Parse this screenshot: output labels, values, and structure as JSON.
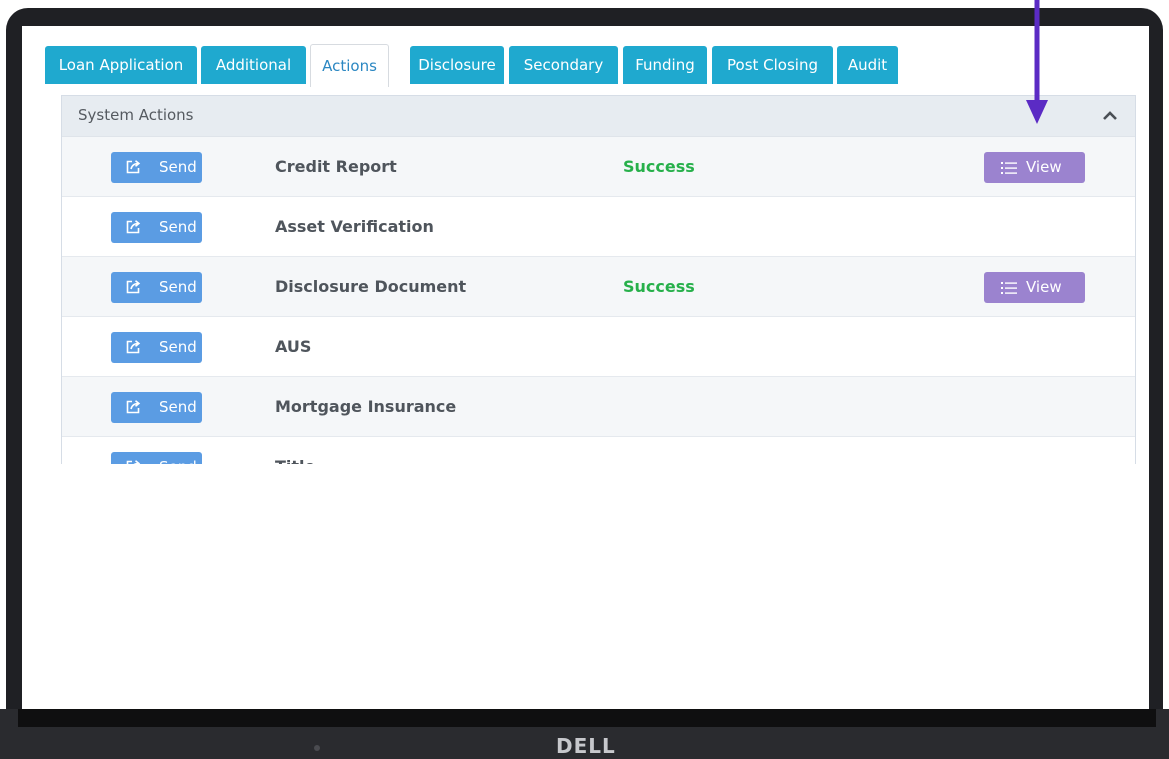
{
  "tabs": [
    {
      "label": "Loan Application",
      "active": false
    },
    {
      "label": "Additional",
      "active": false
    },
    {
      "label": "Actions",
      "active": true
    },
    {
      "label": "Disclosure",
      "active": false
    },
    {
      "label": "Secondary",
      "active": false
    },
    {
      "label": "Funding",
      "active": false
    },
    {
      "label": "Post Closing",
      "active": false
    },
    {
      "label": "Audit",
      "active": false
    }
  ],
  "panel": {
    "title": "System Actions",
    "collapse_icon": "chevron-up-icon"
  },
  "rows": [
    {
      "send_label": "Send",
      "name": "Credit Report",
      "status": "Success",
      "view_label": "View"
    },
    {
      "send_label": "Send",
      "name": "Asset Verification",
      "status": "",
      "view_label": ""
    },
    {
      "send_label": "Send",
      "name": "Disclosure Document",
      "status": "Success",
      "view_label": "View"
    },
    {
      "send_label": "Send",
      "name": "AUS",
      "status": "",
      "view_label": ""
    },
    {
      "send_label": "Send",
      "name": "Mortgage Insurance",
      "status": "",
      "view_label": ""
    },
    {
      "send_label": "Send",
      "name": "Title",
      "status": "",
      "view_label": ""
    }
  ],
  "device": {
    "brand": "DELL"
  },
  "colors": {
    "tab": "#1fa9cf",
    "send_button": "#5b9ce3",
    "view_button": "#9b83cf",
    "success": "#27b04b",
    "arrow": "#5b2bc4"
  }
}
